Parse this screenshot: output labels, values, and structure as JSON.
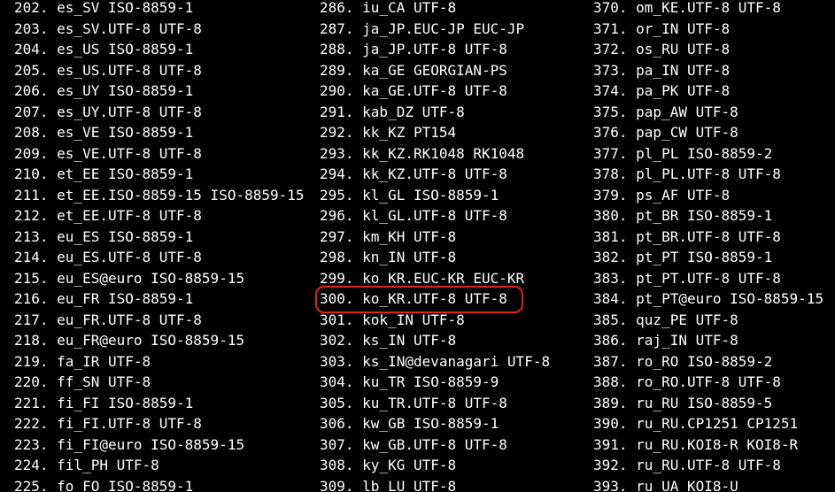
{
  "terminal": {
    "columns": [
      {
        "lines": [
          "202. es_SV ISO-8859-1",
          "203. es_SV.UTF-8 UTF-8",
          "204. es_US ISO-8859-1",
          "205. es_US.UTF-8 UTF-8",
          "206. es_UY ISO-8859-1",
          "207. es_UY.UTF-8 UTF-8",
          "208. es_VE ISO-8859-1",
          "209. es_VE.UTF-8 UTF-8",
          "210. et_EE ISO-8859-1",
          "211. et_EE.ISO-8859-15 ISO-8859-15",
          "212. et_EE.UTF-8 UTF-8",
          "213. eu_ES ISO-8859-1",
          "214. eu_ES.UTF-8 UTF-8",
          "215. eu_ES@euro ISO-8859-15",
          "216. eu_FR ISO-8859-1",
          "217. eu_FR.UTF-8 UTF-8",
          "218. eu_FR@euro ISO-8859-15",
          "219. fa_IR UTF-8",
          "220. ff_SN UTF-8",
          "221. fi_FI ISO-8859-1",
          "222. fi_FI.UTF-8 UTF-8",
          "223. fi_FI@euro ISO-8859-15",
          "224. fil_PH UTF-8",
          "225. fo_FO ISO-8859-1"
        ]
      },
      {
        "lines": [
          "286. iu_CA UTF-8",
          "287. ja_JP.EUC-JP EUC-JP",
          "288. ja_JP.UTF-8 UTF-8",
          "289. ka_GE GEORGIAN-PS",
          "290. ka_GE.UTF-8 UTF-8",
          "291. kab_DZ UTF-8",
          "292. kk_KZ PT154",
          "293. kk_KZ.RK1048 RK1048",
          "294. kk_KZ.UTF-8 UTF-8",
          "295. kl_GL ISO-8859-1",
          "296. kl_GL.UTF-8 UTF-8",
          "297. km_KH UTF-8",
          "298. kn_IN UTF-8",
          "299. ko_KR.EUC-KR EUC-KR",
          "300. ko_KR.UTF-8 UTF-8",
          "301. kok_IN UTF-8",
          "302. ks_IN UTF-8",
          "303. ks_IN@devanagari UTF-8",
          "304. ku_TR ISO-8859-9",
          "305. ku_TR.UTF-8 UTF-8",
          "306. kw_GB ISO-8859-1",
          "307. kw_GB.UTF-8 UTF-8",
          "308. ky_KG UTF-8",
          "309. lb_LU UTF-8"
        ]
      },
      {
        "lines": [
          "370. om_KE.UTF-8 UTF-8",
          "371. or_IN UTF-8",
          "372. os_RU UTF-8",
          "373. pa_IN UTF-8",
          "374. pa_PK UTF-8",
          "375. pap_AW UTF-8",
          "376. pap_CW UTF-8",
          "377. pl_PL ISO-8859-2",
          "378. pl_PL.UTF-8 UTF-8",
          "379. ps_AF UTF-8",
          "380. pt_BR ISO-8859-1",
          "381. pt_BR.UTF-8 UTF-8",
          "382. pt_PT ISO-8859-1",
          "383. pt_PT.UTF-8 UTF-8",
          "384. pt_PT@euro ISO-8859-15",
          "385. quz_PE UTF-8",
          "386. raj_IN UTF-8",
          "387. ro_RO ISO-8859-2",
          "388. ro_RO.UTF-8 UTF-8",
          "389. ru_RU ISO-8859-5",
          "390. ru_RU.CP1251 CP1251",
          "391. ru_RU.KOI8-R KOI8-R",
          "392. ru_RU.UTF-8 UTF-8",
          "393. ru_UA KOI8-U"
        ]
      }
    ],
    "highlight_color": "#e0231f"
  }
}
